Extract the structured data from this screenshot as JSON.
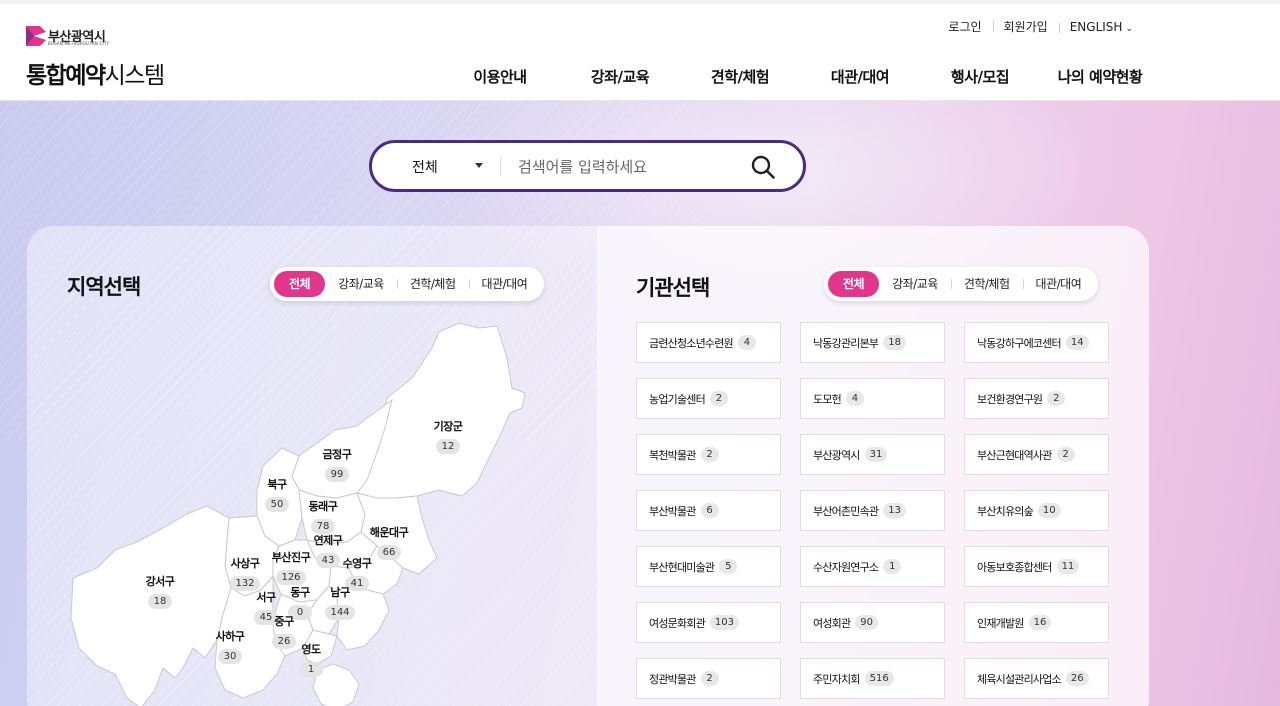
{
  "brand": {
    "city_ko": "부산광역시",
    "city_en": "BUSAN METROPOLITAN CITY",
    "title_bold": "통합예약",
    "title_light": "시스템",
    "accent": "#e2368d"
  },
  "util_nav": {
    "login": "로그인",
    "signup": "회원가입",
    "language": "ENGLISH"
  },
  "gnb": [
    "이용안내",
    "강좌/교육",
    "견학/체험",
    "대관/대여",
    "행사/모집",
    "나의 예약현황"
  ],
  "search": {
    "category": "전체",
    "placeholder": "검색어를 입력하세요",
    "border_color": "#4b2b7f"
  },
  "region_section": {
    "title": "지역선택",
    "tabs": [
      "전체",
      "강좌/교육",
      "견학/체험",
      "대관/대여"
    ],
    "active_tab": "전체",
    "districts": [
      {
        "name": "기장군",
        "count": "12"
      },
      {
        "name": "금정구",
        "count": "99"
      },
      {
        "name": "북구",
        "count": "50"
      },
      {
        "name": "동래구",
        "count": "78"
      },
      {
        "name": "해운대구",
        "count": "66"
      },
      {
        "name": "연제구",
        "count": "43"
      },
      {
        "name": "부산진구",
        "count": "126"
      },
      {
        "name": "수영구",
        "count": "41"
      },
      {
        "name": "사상구",
        "count": "132"
      },
      {
        "name": "강서구",
        "count": "18"
      },
      {
        "name": "동구",
        "count": "0"
      },
      {
        "name": "남구",
        "count": "144"
      },
      {
        "name": "서구",
        "count": "45"
      },
      {
        "name": "중구",
        "count": "26"
      },
      {
        "name": "사하구",
        "count": "30"
      },
      {
        "name": "영도",
        "count": "1"
      }
    ]
  },
  "institution_section": {
    "title": "기관선택",
    "tabs": [
      "전체",
      "강좌/교육",
      "견학/체험",
      "대관/대여"
    ],
    "active_tab": "전체",
    "institutions": [
      {
        "name": "금련산청소년수련원",
        "count": "4"
      },
      {
        "name": "낙동강관리본부",
        "count": "18"
      },
      {
        "name": "낙동강하구에코센터",
        "count": "14"
      },
      {
        "name": "농업기술센터",
        "count": "2"
      },
      {
        "name": "도모헌",
        "count": "4"
      },
      {
        "name": "보건환경연구원",
        "count": "2"
      },
      {
        "name": "복천박물관",
        "count": "2"
      },
      {
        "name": "부산광역시",
        "count": "31"
      },
      {
        "name": "부산근현대역사관",
        "count": "2"
      },
      {
        "name": "부산박물관",
        "count": "6"
      },
      {
        "name": "부산어촌민속관",
        "count": "13"
      },
      {
        "name": "부산치유의숲",
        "count": "10"
      },
      {
        "name": "부산현대미술관",
        "count": "5"
      },
      {
        "name": "수산자원연구소",
        "count": "1"
      },
      {
        "name": "아동보호종합센터",
        "count": "11"
      },
      {
        "name": "여성문화회관",
        "count": "103"
      },
      {
        "name": "여성회관",
        "count": "90"
      },
      {
        "name": "인재개발원",
        "count": "16"
      },
      {
        "name": "정관박물관",
        "count": "2"
      },
      {
        "name": "주민자치회",
        "count": "516"
      },
      {
        "name": "체육시설관리사업소",
        "count": "26"
      }
    ]
  }
}
